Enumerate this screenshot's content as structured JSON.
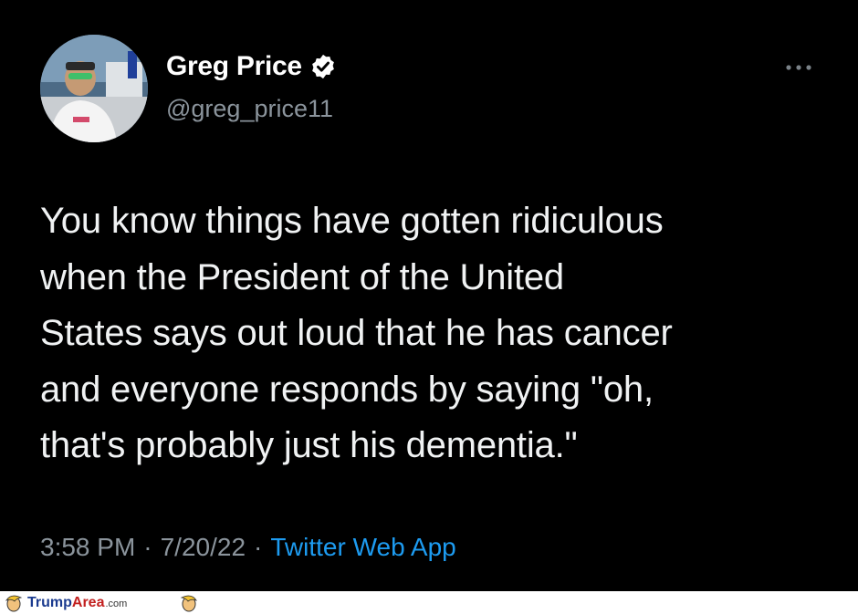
{
  "tweet": {
    "display_name": "Greg Price",
    "handle": "@greg_price11",
    "text": "You know things have gotten ridiculous\nwhen the President of the United\nStates says out loud that he has cancer\nand everyone responds by saying \"oh,\nthat's probably just his dementia.\"",
    "time": "3:58 PM",
    "date": "7/20/22",
    "separator": "·",
    "source": "Twitter Web App",
    "verified": true
  },
  "watermark": {
    "part1": "Trump",
    "part2": "Area",
    "part3": ".com"
  },
  "colors": {
    "background": "#000000",
    "text": "#e7e9ea",
    "muted": "#8b949c",
    "link": "#1d9bf0"
  },
  "icons": {
    "verified": "verified-badge-icon",
    "more": "more-options-icon"
  }
}
